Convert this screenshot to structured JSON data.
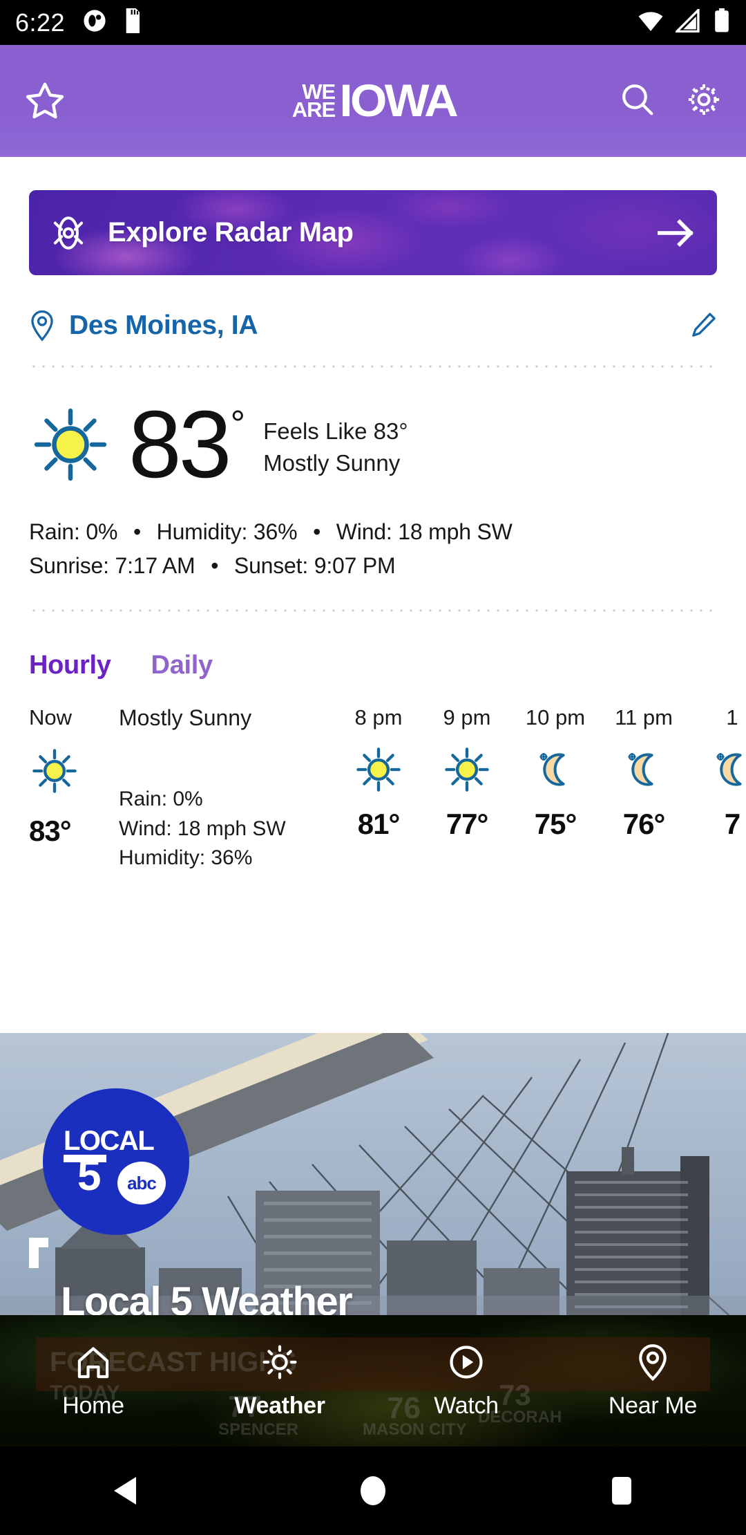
{
  "status_bar": {
    "time": "6:22",
    "icons_left": [
      "notification-icon",
      "sd-card-icon"
    ],
    "icons_right": [
      "wifi-icon",
      "cellular-signal-icon",
      "battery-icon"
    ]
  },
  "app_bar": {
    "favorite_icon": "star-icon",
    "logo_line1": "WE",
    "logo_line2": "ARE",
    "logo_word": "IOWA",
    "search_icon": "search-icon",
    "settings_icon": "gear-icon",
    "background_color": "#8a5fd0"
  },
  "radar_banner": {
    "icon": "radar-hurricane-icon",
    "label": "Explore Radar Map",
    "arrow_icon": "arrow-right-icon",
    "background_color": "#5a2bb4"
  },
  "location": {
    "pin_icon": "location-pin-icon",
    "name": "Des Moines, IA",
    "edit_icon": "pencil-edit-icon",
    "text_color": "#1565a8"
  },
  "current": {
    "condition_icon": "sun-icon",
    "temperature": "83",
    "degree": "°",
    "feels_like": "Feels Like 83°",
    "condition": "Mostly Sunny",
    "rain": "Rain: 0%",
    "humidity": "Humidity: 36%",
    "wind": "Wind: 18 mph SW",
    "sunrise": "Sunrise: 7:17 AM",
    "sunset": "Sunset: 9:07 PM",
    "separator": "•"
  },
  "forecast_tabs": {
    "hourly": "Hourly",
    "daily": "Daily",
    "active": "Hourly",
    "active_color": "#6b21c4",
    "inactive_color": "#9163cc"
  },
  "hourly_forecast": {
    "now": {
      "time": "Now",
      "icon": "sun-icon",
      "temp": "83°",
      "condition": "Mostly Sunny",
      "rain": "Rain: 0%",
      "wind": "Wind: 18 mph SW",
      "humidity": "Humidity: 36%"
    },
    "hours": [
      {
        "time": "8 pm",
        "icon": "sun-icon",
        "temp": "81°"
      },
      {
        "time": "9 pm",
        "icon": "sun-icon",
        "temp": "77°"
      },
      {
        "time": "10 pm",
        "icon": "moon-icon",
        "temp": "75°"
      },
      {
        "time": "11 pm",
        "icon": "moon-icon",
        "temp": "76°"
      },
      {
        "time": "1",
        "icon": "moon-icon",
        "temp": "7"
      }
    ]
  },
  "video_card": {
    "logo_local": "LOCAL",
    "logo_five": "5",
    "logo_abc": "abc",
    "title": "Local 5 Weather",
    "play_icon": "play-flag-icon"
  },
  "bottom_nav": {
    "active": "Weather",
    "items": [
      {
        "label": "Home",
        "icon": "home-icon"
      },
      {
        "label": "Weather",
        "icon": "sun-small-icon"
      },
      {
        "label": "Watch",
        "icon": "play-circle-icon"
      },
      {
        "label": "Near Me",
        "icon": "location-pin-icon"
      }
    ]
  },
  "map_labels": {
    "headline": "FORECAST HIGHS",
    "sub": "TODAY",
    "cities": [
      {
        "temp": "77",
        "name": "SPENCER"
      },
      {
        "temp": "76",
        "name": "MASON CITY"
      },
      {
        "temp": "73",
        "name": "DECORAH"
      }
    ]
  },
  "android_nav": {
    "back": "back-triangle-icon",
    "home": "home-circle-icon",
    "recents": "recents-square-icon"
  }
}
